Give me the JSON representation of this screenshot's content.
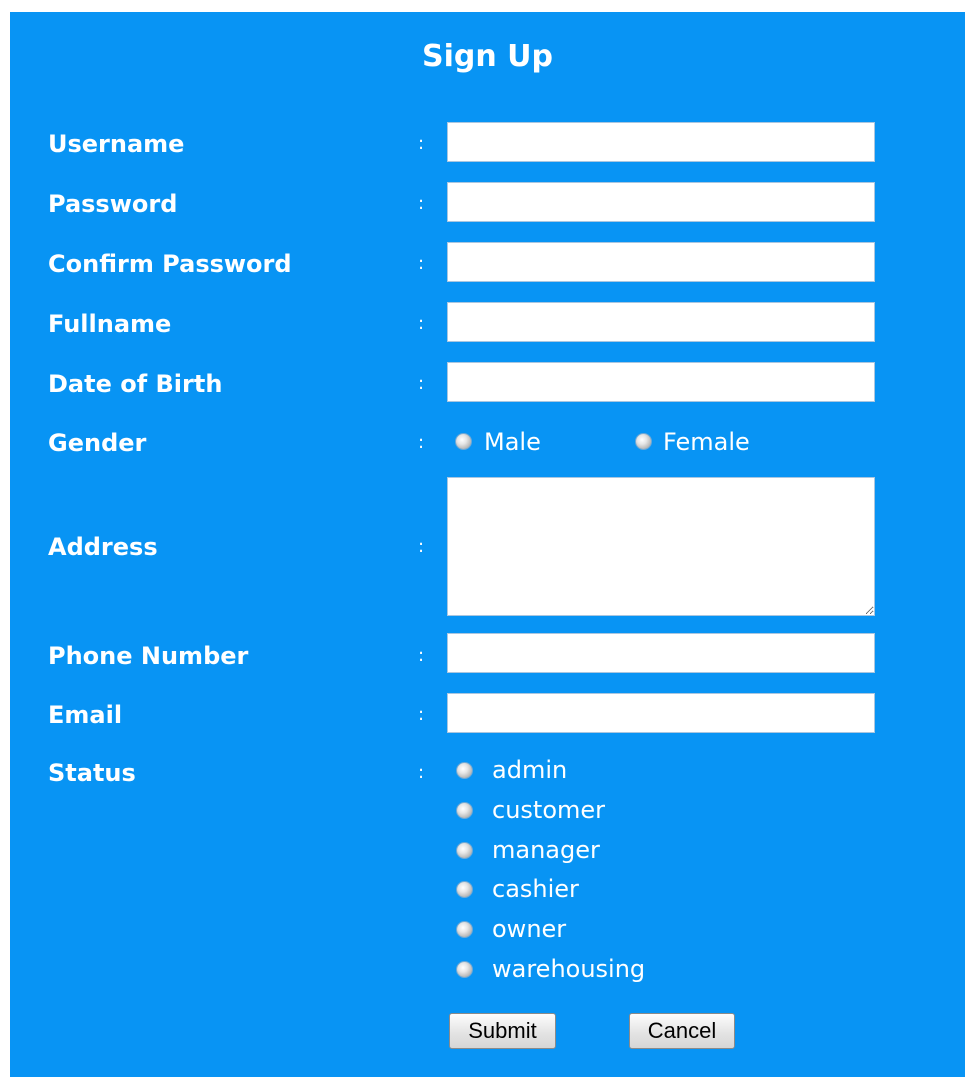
{
  "form": {
    "title": "Sign Up",
    "colon": ":",
    "labels": {
      "username": "Username",
      "password": "Password",
      "confirm_password": "Confirm Password",
      "fullname": "Fullname",
      "date_of_birth": "Date of Birth",
      "gender": "Gender",
      "address": "Address",
      "phone_number": "Phone Number",
      "email": "Email",
      "status": "Status"
    },
    "values": {
      "username": "",
      "password": "",
      "confirm_password": "",
      "fullname": "",
      "date_of_birth": "",
      "address": "",
      "phone_number": "",
      "email": ""
    },
    "gender_options": [
      "Male",
      "Female"
    ],
    "status_options": [
      "admin",
      "customer",
      "manager",
      "cashier",
      "owner",
      "warehousing"
    ],
    "buttons": {
      "submit": "Submit",
      "cancel": "Cancel"
    }
  },
  "colors": {
    "background": "#0894f4",
    "text": "#ffffff"
  }
}
